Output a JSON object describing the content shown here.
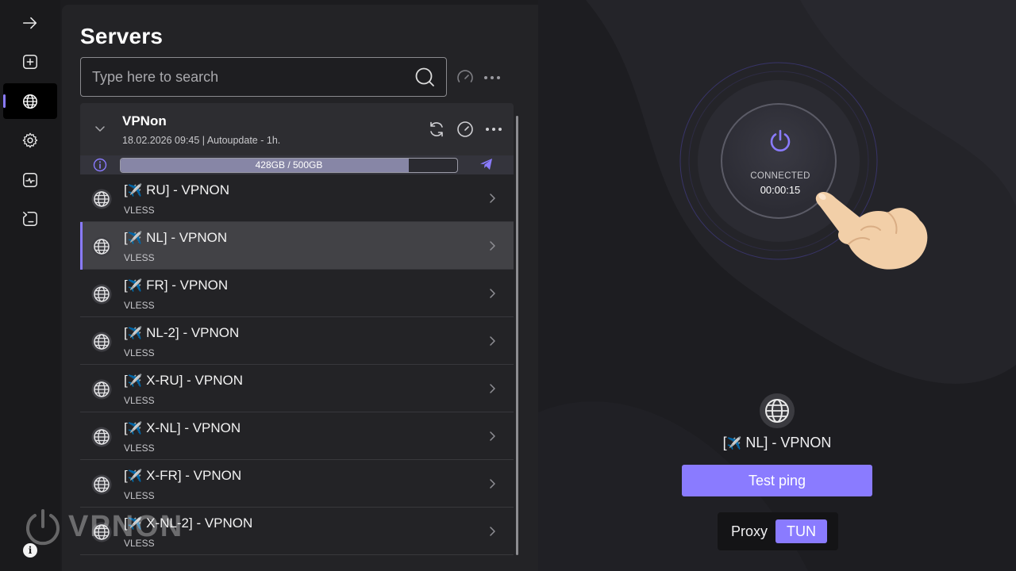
{
  "panel": {
    "title": "Servers",
    "search": {
      "placeholder": "Type here to search"
    }
  },
  "group": {
    "name": "VPNon",
    "meta": "18.02.2026 09:45 | Autoupdate - 1h.",
    "quota": {
      "label": "428GB / 500GB",
      "used_gb": 428,
      "total_gb": 500
    }
  },
  "servers": [
    {
      "prefix": "[",
      "emoji": "✈️",
      "name": "RU] - VPNON",
      "protocol": "VLESS"
    },
    {
      "prefix": "[",
      "emoji": "✈️",
      "name": "NL] - VPNON",
      "protocol": "VLESS"
    },
    {
      "prefix": "[",
      "emoji": "✈️",
      "name": "FR] - VPNON",
      "protocol": "VLESS"
    },
    {
      "prefix": "[",
      "emoji": "✈️",
      "name": "NL-2] - VPNON",
      "protocol": "VLESS"
    },
    {
      "prefix": "[",
      "emoji": "✈️",
      "name": "X-RU] - VPNON",
      "protocol": "VLESS"
    },
    {
      "prefix": "[",
      "emoji": "✈️",
      "name": "X-NL] - VPNON",
      "protocol": "VLESS"
    },
    {
      "prefix": "[",
      "emoji": "✈️",
      "name": "X-FR] - VPNON",
      "protocol": "VLESS"
    },
    {
      "prefix": "[",
      "emoji": "✈️",
      "name": "X-NL-2] - VPNON",
      "protocol": "VLESS"
    }
  ],
  "selected_index": 1,
  "connection": {
    "status": "CONNECTED",
    "timer": "00:00:15",
    "current_server": {
      "prefix": "[",
      "emoji": "✈️",
      "name": "NL] - VPNON"
    },
    "ping_button": "Test ping",
    "mode_proxy": "Proxy",
    "mode_tun": "TUN",
    "active_mode": "TUN"
  },
  "watermark": "VPNON",
  "info_badge": "i",
  "colors": {
    "accent": "#8a7bff",
    "panel": "#232326",
    "selected_row": "#424246"
  }
}
